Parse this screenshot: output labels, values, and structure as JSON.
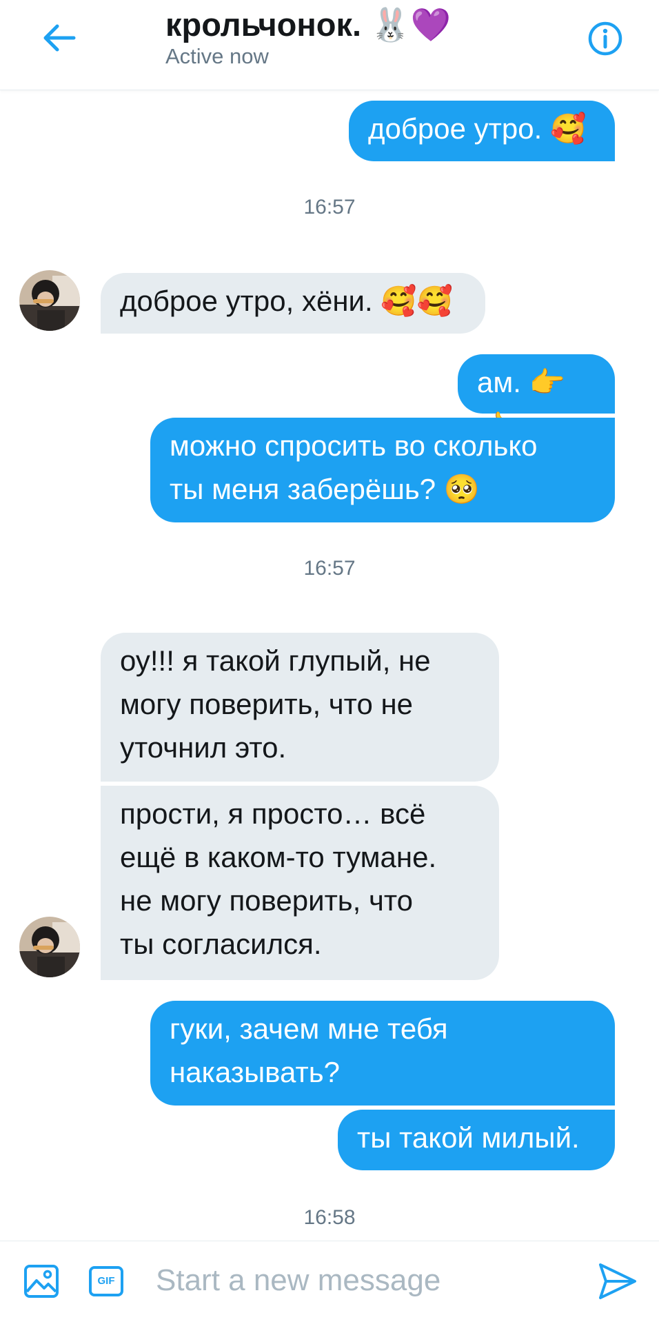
{
  "header": {
    "title": "крольчонок. 🐰💜",
    "status": "Active now"
  },
  "messages": [
    {
      "text": "доброе утро. 🥰"
    },
    {
      "text": "доброе утро, хёни. 🥰🥰"
    },
    {
      "text": "ам. 👉👈"
    },
    {
      "text": "можно спросить во сколько\nты меня заберёшь? 🥺"
    },
    {
      "text": "оу!!! я такой глупый, не\nмогу поверить, что не\nуточнил это."
    },
    {
      "text": "прости, я просто… всё\nещё в каком-то тумане.\nне могу поверить, что\nты согласился."
    },
    {
      "text": "гуки, зачем мне тебя\nнаказывать?"
    },
    {
      "text": "ты такой милый."
    }
  ],
  "timestamps": [
    "16:57",
    "16:57",
    "16:58"
  ],
  "composer": {
    "placeholder": "Start a new message",
    "gif_label": "GIF"
  },
  "colors": {
    "accent": "#1da1f2",
    "incoming_bubble": "#e6ecf0",
    "text": "#14171a",
    "muted": "#657786"
  }
}
